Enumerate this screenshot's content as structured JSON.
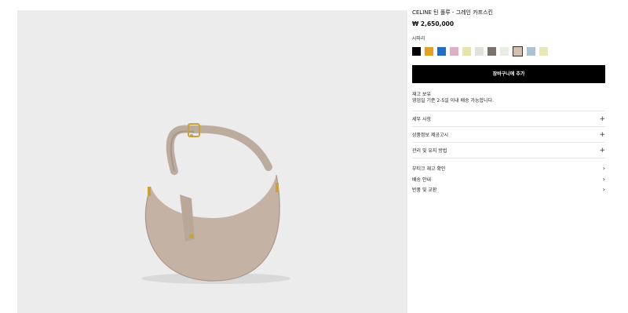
{
  "product": {
    "title": "CELINE 틴 폴루 - 그레인 카프스킨",
    "price": "₩ 2,650,000"
  },
  "color_label": "사파리",
  "swatches": [
    {
      "name": "black",
      "color": "#000000",
      "selected": false
    },
    {
      "name": "orange",
      "color": "#e8a022",
      "selected": false
    },
    {
      "name": "blue",
      "color": "#1f6fc6",
      "selected": false
    },
    {
      "name": "pink",
      "color": "#e0afc4",
      "selected": false
    },
    {
      "name": "light-yellow",
      "color": "#e8e3a8",
      "selected": false
    },
    {
      "name": "light-gray",
      "color": "#e2e2dc",
      "selected": false
    },
    {
      "name": "taupe-dark",
      "color": "#7d716c",
      "selected": false
    },
    {
      "name": "off-white",
      "color": "#ebebe6",
      "selected": false
    },
    {
      "name": "beige",
      "color": "#d7bfad",
      "selected": true
    },
    {
      "name": "light-blue",
      "color": "#a9c2d4",
      "selected": false
    },
    {
      "name": "pale-yellow",
      "color": "#e6e9b5",
      "selected": false
    }
  ],
  "add_to_cart_label": "장바구니에 추가",
  "stock": {
    "line1": "재고 보유",
    "line2": "영업일 기준 2-5일 이내 배송 가능합니다."
  },
  "accordion": [
    {
      "label": "세부 사항",
      "icon": "plus-icon"
    },
    {
      "label": "상품정보 제공고시",
      "icon": "plus-icon"
    },
    {
      "label": "관리 및 유지 방법",
      "icon": "plus-icon"
    }
  ],
  "links": [
    {
      "label": "부티크 재고 확인",
      "icon": "chevron-right-icon"
    },
    {
      "label": "배송 안내",
      "icon": "chevron-right-icon"
    },
    {
      "label": "반품 및 교환",
      "icon": "chevron-right-icon"
    }
  ],
  "plus_glyph": "+",
  "chevron_glyph": "›"
}
